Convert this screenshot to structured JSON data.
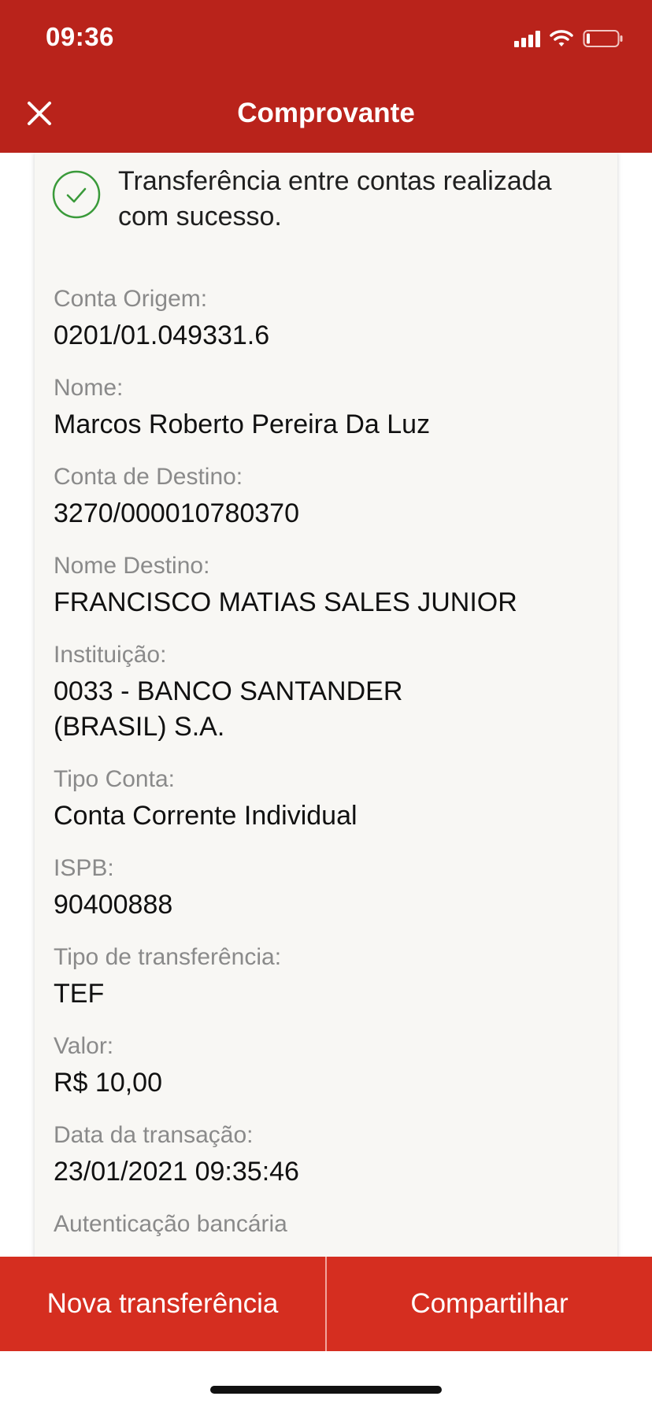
{
  "status_bar": {
    "time": "09:36"
  },
  "header": {
    "title": "Comprovante",
    "close_icon": "close-icon"
  },
  "success": {
    "message": "Transferência entre contas realizada com sucesso."
  },
  "fields": [
    {
      "label": "Conta Origem:",
      "value": "0201/01.049331.6"
    },
    {
      "label": "Nome:",
      "value": "Marcos Roberto Pereira Da Luz"
    },
    {
      "label": "Conta de Destino:",
      "value": "3270/000010780370"
    },
    {
      "label": "Nome Destino:",
      "value": "FRANCISCO MATIAS SALES JUNIOR"
    },
    {
      "label": "Instituição:",
      "value": "0033 - BANCO SANTANDER (BRASIL) S.A."
    },
    {
      "label": "Tipo Conta:",
      "value": "Conta Corrente Individual"
    },
    {
      "label": "ISPB:",
      "value": "90400888"
    },
    {
      "label": "Tipo de transferência:",
      "value": "TEF"
    },
    {
      "label": "Valor:",
      "value": "R$ 10,00"
    },
    {
      "label": "Data da transação:",
      "value": "23/01/2021 09:35:46"
    },
    {
      "label": "Autenticação bancária",
      "value": ""
    }
  ],
  "actions": {
    "new_transfer": "Nova transferência",
    "share": "Compartilhar"
  },
  "colors": {
    "header_bg": "#b9231b",
    "button_bg": "#d52e20",
    "success_green": "#3a9a3a"
  }
}
